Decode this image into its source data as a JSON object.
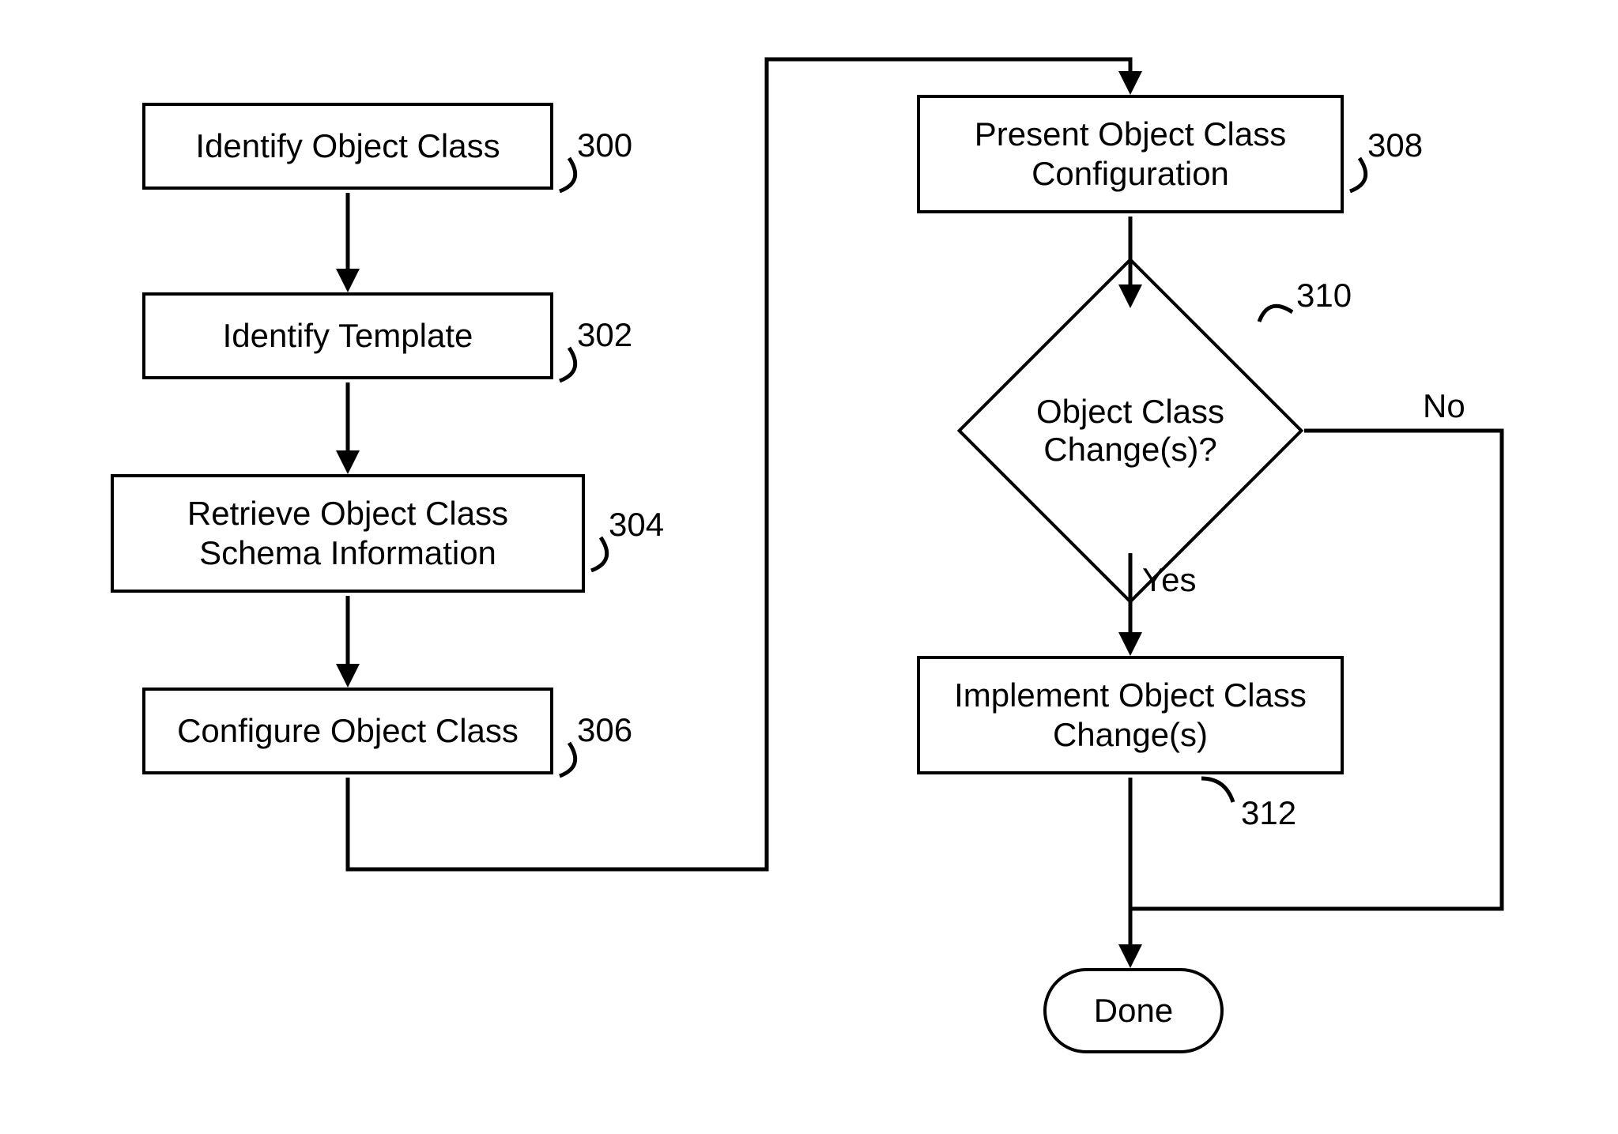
{
  "nodes": {
    "n300": {
      "label": "Identify Object Class",
      "ref": "300"
    },
    "n302": {
      "label": "Identify Template",
      "ref": "302"
    },
    "n304": {
      "label": "Retrieve Object Class Schema Information",
      "ref": "304"
    },
    "n306": {
      "label": "Configure Object Class",
      "ref": "306"
    },
    "n308": {
      "label": "Present Object Class Configuration",
      "ref": "308"
    },
    "n310": {
      "label": "Object Class Change(s)?",
      "ref": "310"
    },
    "n312": {
      "label": "Implement Object Class Change(s)",
      "ref": "312"
    },
    "done": {
      "label": "Done"
    }
  },
  "edges": {
    "no": "No",
    "yes": "Yes"
  }
}
